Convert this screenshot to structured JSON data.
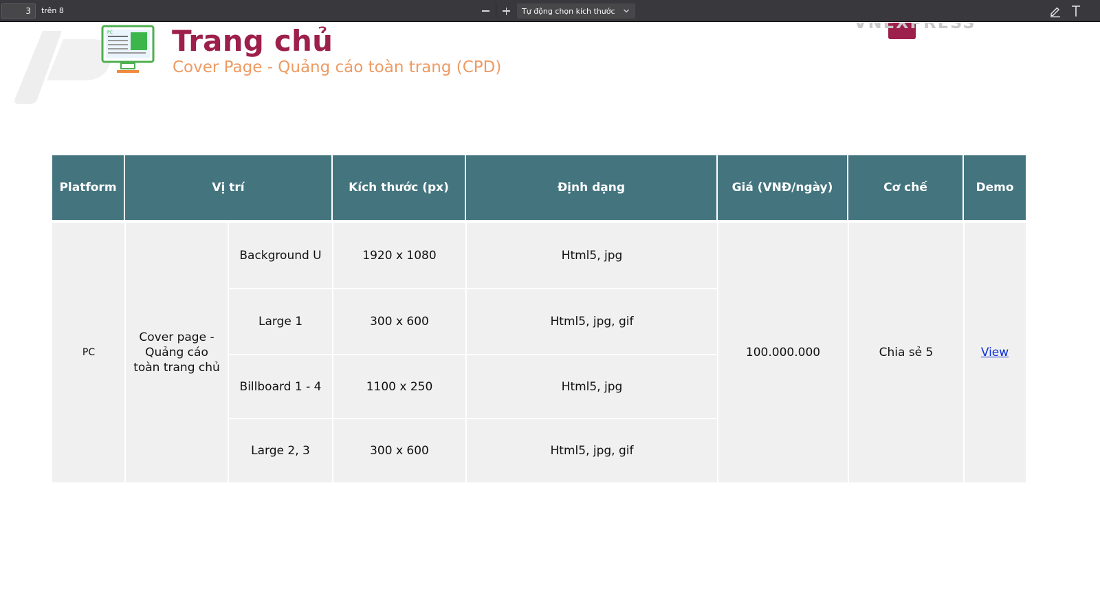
{
  "toolbar": {
    "page_number": "3",
    "page_of": "trên 8",
    "zoom_out_icon": "minus-icon",
    "zoom_in_icon": "plus-icon",
    "scale_value": "Tự động chọn kích thước",
    "right_icons": [
      "pencil-icon",
      "text-tool-icon"
    ]
  },
  "header": {
    "title": "Trang chủ",
    "subtitle": "Cover Page - Quảng cáo toàn trang (CPD)",
    "monitor_badge": "PC",
    "brand": "VNEXPRESS"
  },
  "colors": {
    "title": "#9d1f4b",
    "subtitle": "#ee9a62",
    "header_bg": "#44757f",
    "cell_bg": "#f0f0f0",
    "link": "#0b2fd6",
    "brand_accent": "#9d1f4b"
  },
  "table": {
    "headers": [
      "Platform",
      "Vị trí",
      "Kích thước (px)",
      "Định dạng",
      "Giá (VNĐ/ngày)",
      "Cơ chế",
      "Demo"
    ],
    "platform": "PC",
    "position_group": "Cover page - Quảng cáo toàn trang chủ",
    "rows": [
      {
        "position": "Background U",
        "size": "1920 x 1080",
        "format": "Html5, jpg"
      },
      {
        "position": "Large 1",
        "size": "300 x 600",
        "format": "Html5, jpg, gif"
      },
      {
        "position": "Billboard 1 - 4",
        "size": "1100 x 250",
        "format": "Html5, jpg"
      },
      {
        "position": "Large 2, 3",
        "size": "300 x 600",
        "format": "Html5, jpg, gif"
      }
    ],
    "price": "100.000.000",
    "mechanism": "Chia sẻ 5",
    "demo_link": "View"
  }
}
